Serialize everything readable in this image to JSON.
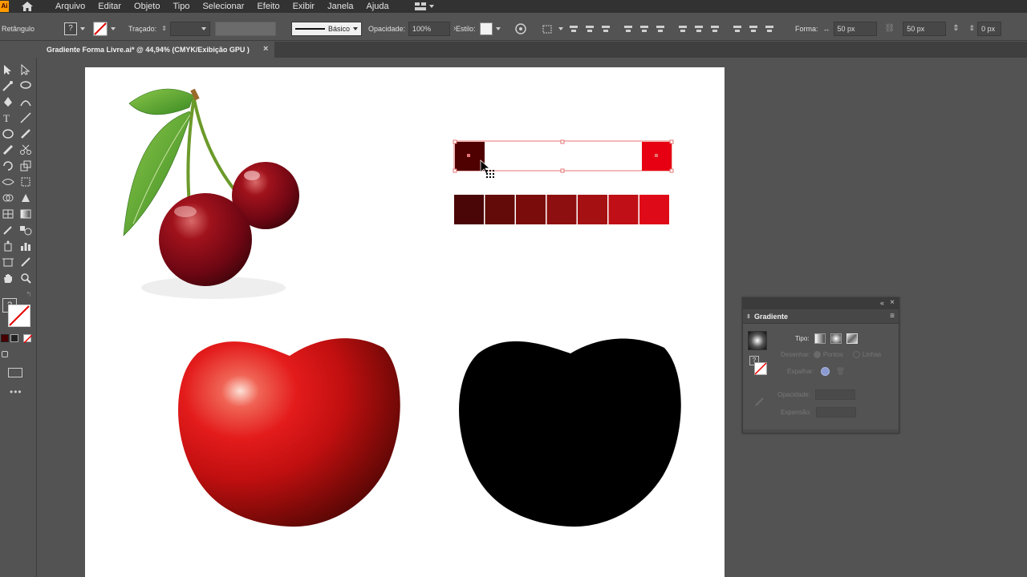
{
  "menubar": {
    "app_logo": "Ai",
    "items": [
      "Arquivo",
      "Editar",
      "Objeto",
      "Tipo",
      "Selecionar",
      "Efeito",
      "Exibir",
      "Janela",
      "Ajuda"
    ]
  },
  "controlbar": {
    "object_type": "Retângulo",
    "stroke_label": "Traçado:",
    "brush_label": "Básico",
    "opacity_label": "Opacidade:",
    "opacity_value": "100%",
    "style_label": "Estilo:",
    "shape_label": "Forma:",
    "width_value": "50 px",
    "height_value": "50 px",
    "corner_value": "0 px"
  },
  "document": {
    "tab_title": "Gradiente Forma Livre.ai* @ 44,94% (CMYK/Exibição GPU )",
    "close_symbol": "×"
  },
  "artwork": {
    "top_bar_colors": [
      "#4f0000",
      "#e60012"
    ],
    "swatch_colors": [
      "#4a0606",
      "#630b08",
      "#7a0d0b",
      "#8e0f0f",
      "#a51013",
      "#c00f16",
      "#df0a17"
    ]
  },
  "gradient_panel": {
    "title": "Gradiente",
    "tipo_label": "Tipo:",
    "desenhar_label": "Desenhar:",
    "pontos_label": "Pontos",
    "linhas_label": "Linhas",
    "espalhar_label": "Espalhar:",
    "opacidade_label": "Opacidade:",
    "expansao_label": "Expansão:"
  }
}
